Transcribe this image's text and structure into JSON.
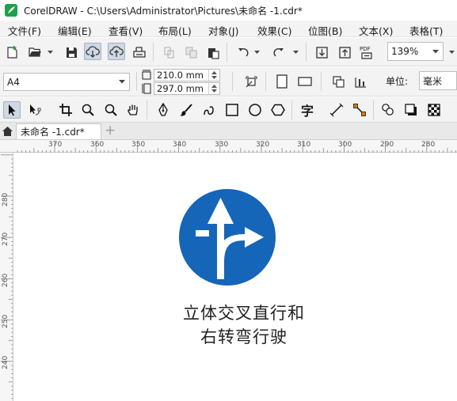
{
  "window": {
    "title": "CorelDRAW - C:\\Users\\Administrator\\Pictures\\未命名 -1.cdr*"
  },
  "menubar": {
    "items": [
      {
        "label": "文件(F)"
      },
      {
        "label": "编辑(E)"
      },
      {
        "label": "查看(V)"
      },
      {
        "label": "布局(L)"
      },
      {
        "label": "对象(J)"
      },
      {
        "label": "效果(C)"
      },
      {
        "label": "位图(B)"
      },
      {
        "label": "文本(X)"
      },
      {
        "label": "表格(T)"
      }
    ]
  },
  "toolbar": {
    "zoom_value": "139%",
    "pdf_label": "PDF"
  },
  "propertybar": {
    "page_size": "A4",
    "width_value": "210.0 mm",
    "height_value": "297.0 mm",
    "units_label": "单位:",
    "units_value": "毫米"
  },
  "toolbox": {
    "text_tool_glyph": "字"
  },
  "document_tabs": {
    "active_tab": "未命名 -1.cdr*",
    "new_tab_symbol": "+"
  },
  "rulers": {
    "horizontal_labels": [
      "370",
      "360",
      "350",
      "340",
      "330",
      "320",
      "310",
      "300",
      "290",
      "280"
    ],
    "vertical_labels": [
      "280",
      "270",
      "260",
      "250",
      "240"
    ]
  },
  "canvas": {
    "sign_color": "#1565b8",
    "caption_line1": "立体交叉直行和",
    "caption_line2": "右转弯行驶"
  },
  "colors": {
    "accent": "#1565b8",
    "chrome": "#f3f3f3",
    "pressed": "#cfd8e3"
  }
}
